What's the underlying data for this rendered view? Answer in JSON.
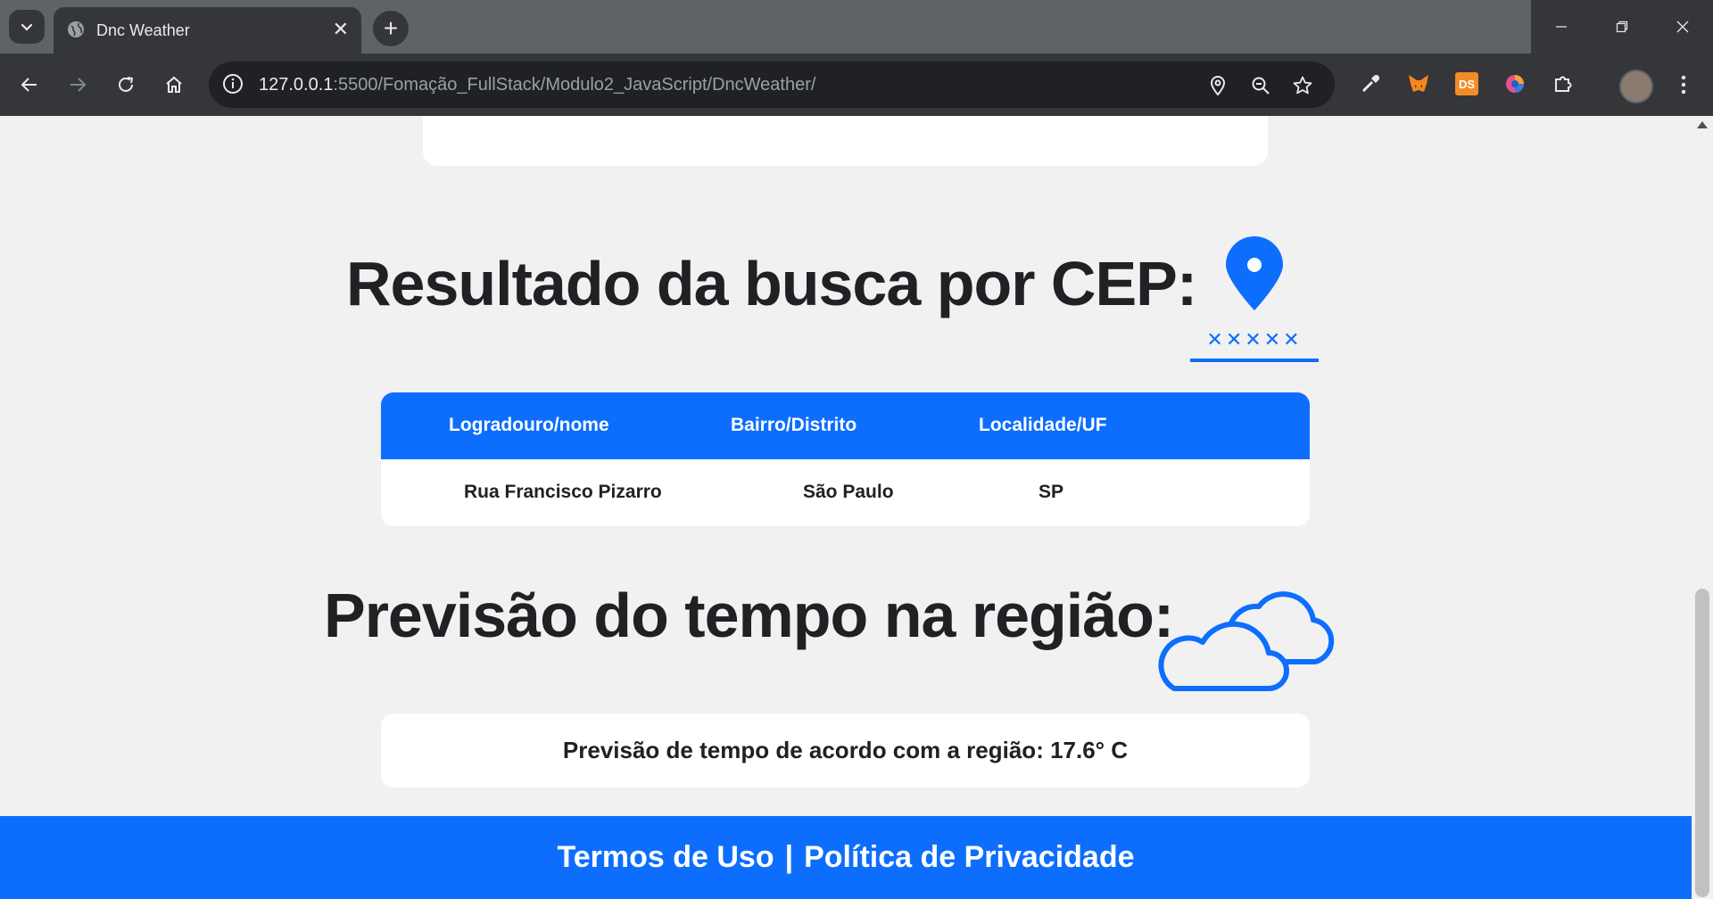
{
  "browser": {
    "tab_title": "Dnc Weather",
    "url_host": "127.0.0.1",
    "url_rest": ":5500/Fomação_FullStack/Modulo2_JavaScript/DncWeather/",
    "extensions": {
      "ds_label": "DS"
    }
  },
  "page": {
    "cep_heading": "Resultado da busca por CEP:",
    "cep_placeholder_mark": "✕✕✕✕✕",
    "cep_table": {
      "headers": [
        "Logradouro/nome",
        "Bairro/Distrito",
        "Localidade/UF"
      ],
      "row": [
        "Rua Francisco Pizarro",
        "São Paulo",
        "SP"
      ]
    },
    "weather_heading": "Previsão do tempo na região:",
    "forecast_text": "Previsão de tempo de acordo com a região: 17.6° C",
    "footer": {
      "terms": "Termos de Uso",
      "separator": "|",
      "privacy": "Política de Privacidade"
    }
  },
  "colors": {
    "accent": "#0d6efd",
    "page_bg": "#f1f1f1",
    "chrome_dark": "#35363a"
  }
}
